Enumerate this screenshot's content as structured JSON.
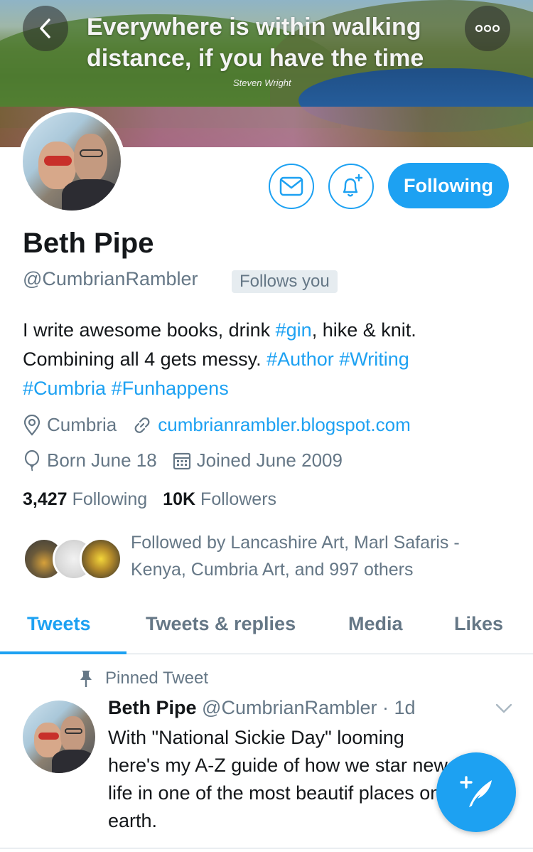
{
  "banner": {
    "quote": "Everywhere is within walking distance, if you have the time",
    "credit": "Steven Wright"
  },
  "actions": {
    "follow_label": "Following"
  },
  "profile": {
    "name": "Beth Pipe",
    "handle": "@CumbrianRambler",
    "follows_you": "Follows you",
    "bio": {
      "line1_pre": "I write awesome books, drink ",
      "tag_gin": "#gin",
      "line1_post": ", hike & knit.",
      "line2_pre": "Combining all 4 gets messy. ",
      "tag_author": "#Author",
      "tag_writing": "#Writing",
      "tag_cumbria": "#Cumbria",
      "tag_funhappens": "#Funhappens"
    },
    "location": "Cumbria",
    "website": "cumbrianrambler.blogspot.com",
    "birthday": "Born June 18",
    "joined": "Joined June 2009",
    "following_count": "3,427",
    "following_label": "Following",
    "followers_count": "10K",
    "followers_label": "Followers",
    "followed_by": "Followed by Lancashire Art, Marl Safaris - Kenya, Cumbria Art, and 997 others"
  },
  "tabs": [
    "Tweets",
    "Tweets & replies",
    "Media",
    "Likes"
  ],
  "pinned_tweet": {
    "label": "Pinned Tweet",
    "name": "Beth Pipe",
    "handle": "@CumbrianRambler",
    "time": "· 1d",
    "text": "With \"National Sickie Day\" looming here's my A-Z guide of how we star new life in one of the most beautif places on earth."
  },
  "colors": {
    "accent": "#1da1f2",
    "secondary_text": "#657786",
    "primary_text": "#14171a"
  },
  "icons": [
    "back-arrow-icon",
    "more-dots-icon",
    "mail-icon",
    "bell-plus-icon",
    "location-pin-icon",
    "link-icon",
    "balloon-icon",
    "calendar-icon",
    "pin-icon",
    "chevron-down-icon",
    "compose-tweet-icon"
  ]
}
